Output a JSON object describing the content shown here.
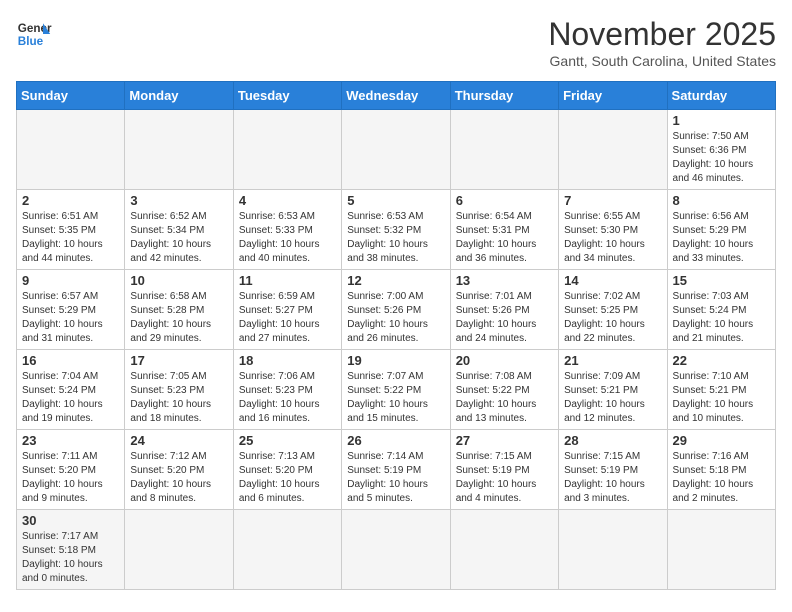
{
  "header": {
    "logo_general": "General",
    "logo_blue": "Blue",
    "month_title": "November 2025",
    "location": "Gantt, South Carolina, United States"
  },
  "days_of_week": [
    "Sunday",
    "Monday",
    "Tuesday",
    "Wednesday",
    "Thursday",
    "Friday",
    "Saturday"
  ],
  "weeks": [
    [
      {
        "day": "",
        "info": ""
      },
      {
        "day": "",
        "info": ""
      },
      {
        "day": "",
        "info": ""
      },
      {
        "day": "",
        "info": ""
      },
      {
        "day": "",
        "info": ""
      },
      {
        "day": "",
        "info": ""
      },
      {
        "day": "1",
        "info": "Sunrise: 7:50 AM\nSunset: 6:36 PM\nDaylight: 10 hours and 46 minutes."
      }
    ],
    [
      {
        "day": "2",
        "info": "Sunrise: 6:51 AM\nSunset: 5:35 PM\nDaylight: 10 hours and 44 minutes."
      },
      {
        "day": "3",
        "info": "Sunrise: 6:52 AM\nSunset: 5:34 PM\nDaylight: 10 hours and 42 minutes."
      },
      {
        "day": "4",
        "info": "Sunrise: 6:53 AM\nSunset: 5:33 PM\nDaylight: 10 hours and 40 minutes."
      },
      {
        "day": "5",
        "info": "Sunrise: 6:53 AM\nSunset: 5:32 PM\nDaylight: 10 hours and 38 minutes."
      },
      {
        "day": "6",
        "info": "Sunrise: 6:54 AM\nSunset: 5:31 PM\nDaylight: 10 hours and 36 minutes."
      },
      {
        "day": "7",
        "info": "Sunrise: 6:55 AM\nSunset: 5:30 PM\nDaylight: 10 hours and 34 minutes."
      },
      {
        "day": "8",
        "info": "Sunrise: 6:56 AM\nSunset: 5:29 PM\nDaylight: 10 hours and 33 minutes."
      }
    ],
    [
      {
        "day": "9",
        "info": "Sunrise: 6:57 AM\nSunset: 5:29 PM\nDaylight: 10 hours and 31 minutes."
      },
      {
        "day": "10",
        "info": "Sunrise: 6:58 AM\nSunset: 5:28 PM\nDaylight: 10 hours and 29 minutes."
      },
      {
        "day": "11",
        "info": "Sunrise: 6:59 AM\nSunset: 5:27 PM\nDaylight: 10 hours and 27 minutes."
      },
      {
        "day": "12",
        "info": "Sunrise: 7:00 AM\nSunset: 5:26 PM\nDaylight: 10 hours and 26 minutes."
      },
      {
        "day": "13",
        "info": "Sunrise: 7:01 AM\nSunset: 5:26 PM\nDaylight: 10 hours and 24 minutes."
      },
      {
        "day": "14",
        "info": "Sunrise: 7:02 AM\nSunset: 5:25 PM\nDaylight: 10 hours and 22 minutes."
      },
      {
        "day": "15",
        "info": "Sunrise: 7:03 AM\nSunset: 5:24 PM\nDaylight: 10 hours and 21 minutes."
      }
    ],
    [
      {
        "day": "16",
        "info": "Sunrise: 7:04 AM\nSunset: 5:24 PM\nDaylight: 10 hours and 19 minutes."
      },
      {
        "day": "17",
        "info": "Sunrise: 7:05 AM\nSunset: 5:23 PM\nDaylight: 10 hours and 18 minutes."
      },
      {
        "day": "18",
        "info": "Sunrise: 7:06 AM\nSunset: 5:23 PM\nDaylight: 10 hours and 16 minutes."
      },
      {
        "day": "19",
        "info": "Sunrise: 7:07 AM\nSunset: 5:22 PM\nDaylight: 10 hours and 15 minutes."
      },
      {
        "day": "20",
        "info": "Sunrise: 7:08 AM\nSunset: 5:22 PM\nDaylight: 10 hours and 13 minutes."
      },
      {
        "day": "21",
        "info": "Sunrise: 7:09 AM\nSunset: 5:21 PM\nDaylight: 10 hours and 12 minutes."
      },
      {
        "day": "22",
        "info": "Sunrise: 7:10 AM\nSunset: 5:21 PM\nDaylight: 10 hours and 10 minutes."
      }
    ],
    [
      {
        "day": "23",
        "info": "Sunrise: 7:11 AM\nSunset: 5:20 PM\nDaylight: 10 hours and 9 minutes."
      },
      {
        "day": "24",
        "info": "Sunrise: 7:12 AM\nSunset: 5:20 PM\nDaylight: 10 hours and 8 minutes."
      },
      {
        "day": "25",
        "info": "Sunrise: 7:13 AM\nSunset: 5:20 PM\nDaylight: 10 hours and 6 minutes."
      },
      {
        "day": "26",
        "info": "Sunrise: 7:14 AM\nSunset: 5:19 PM\nDaylight: 10 hours and 5 minutes."
      },
      {
        "day": "27",
        "info": "Sunrise: 7:15 AM\nSunset: 5:19 PM\nDaylight: 10 hours and 4 minutes."
      },
      {
        "day": "28",
        "info": "Sunrise: 7:15 AM\nSunset: 5:19 PM\nDaylight: 10 hours and 3 minutes."
      },
      {
        "day": "29",
        "info": "Sunrise: 7:16 AM\nSunset: 5:18 PM\nDaylight: 10 hours and 2 minutes."
      }
    ],
    [
      {
        "day": "30",
        "info": "Sunrise: 7:17 AM\nSunset: 5:18 PM\nDaylight: 10 hours and 0 minutes.",
        "last": true
      },
      {
        "day": "",
        "info": "",
        "last": true
      },
      {
        "day": "",
        "info": "",
        "last": true
      },
      {
        "day": "",
        "info": "",
        "last": true
      },
      {
        "day": "",
        "info": "",
        "last": true
      },
      {
        "day": "",
        "info": "",
        "last": true
      },
      {
        "day": "",
        "info": "",
        "last": true
      }
    ]
  ]
}
